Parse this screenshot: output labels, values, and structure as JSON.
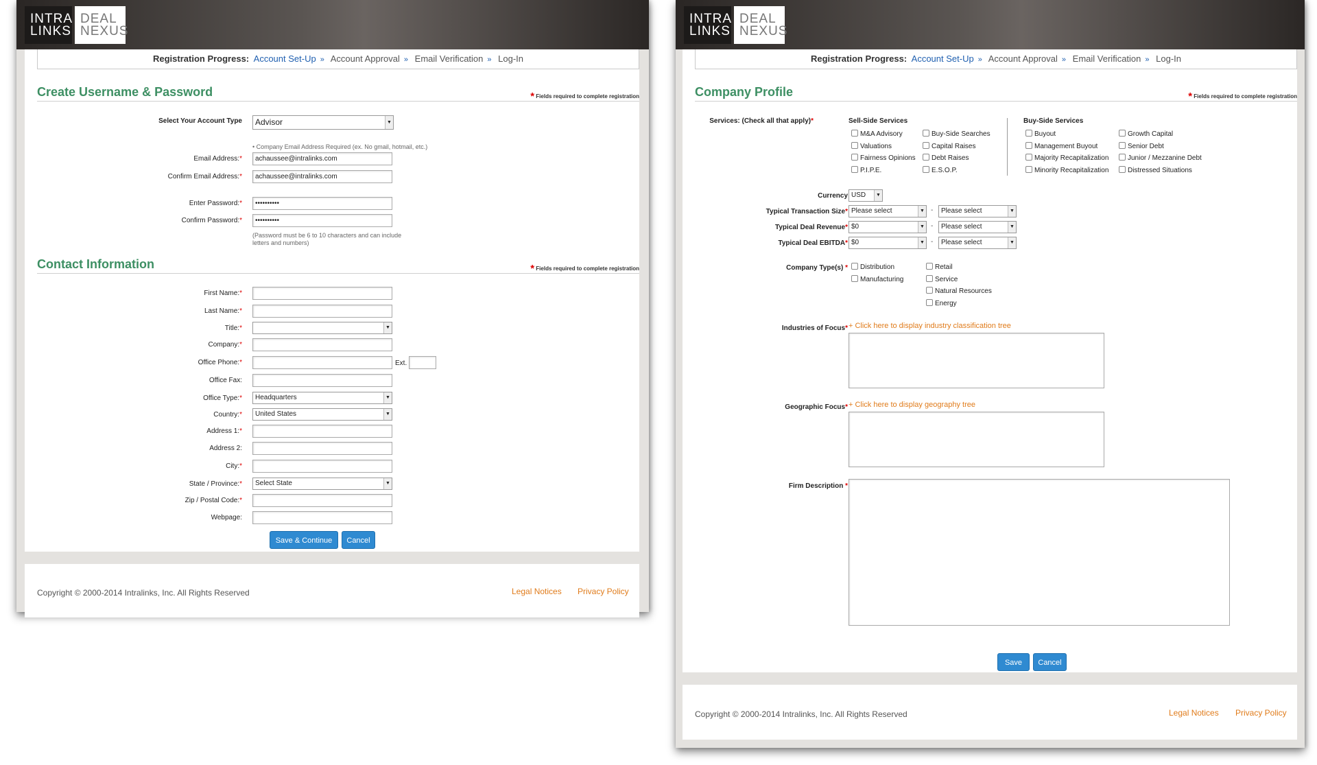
{
  "brand": {
    "logo_left_line1": "INTRA",
    "logo_left_line2": "LINKS",
    "logo_right_line1": "DEAL",
    "logo_right_line2": "NEXUS"
  },
  "progress": {
    "label": "Registration Progress:",
    "steps": [
      "Account Set-Up",
      "Account Approval",
      "Email Verification",
      "Log-In"
    ],
    "separator": "»"
  },
  "required_note": "Fields required to complete registration",
  "left": {
    "section1_title": "Create Username & Password",
    "account_type_label": "Select Your Account Type",
    "account_type_value": "Advisor",
    "email_note": "Company Email Address Required (ex. No gmail, hotmail, etc.)",
    "email_label": "Email Address:",
    "email_value": "achaussee@intralinks.com",
    "confirm_email_label": "Confirm Email Address:",
    "confirm_email_value": "achaussee@intralinks.com",
    "password_label": "Enter Password:",
    "password_value": "••••••••••",
    "confirm_password_label": "Confirm Password:",
    "confirm_password_value": "••••••••••",
    "password_note": "(Password must be 6 to 10 characters and can include letters and numbers)",
    "section2_title": "Contact Information",
    "first_name_label": "First Name:",
    "last_name_label": "Last Name:",
    "title_label": "Title:",
    "company_label": "Company:",
    "office_phone_label": "Office Phone:",
    "ext_label": "Ext.",
    "office_fax_label": "Office Fax:",
    "office_type_label": "Office Type:",
    "office_type_value": "Headquarters",
    "country_label": "Country:",
    "country_value": "United States",
    "address1_label": "Address 1:",
    "address2_label": "Address 2:",
    "city_label": "City:",
    "state_label": "State / Province:",
    "state_value": "Select State",
    "zip_label": "Zip / Postal Code:",
    "webpage_label": "Webpage:",
    "save_continue": "Save & Continue",
    "cancel": "Cancel"
  },
  "right": {
    "section_title": "Company Profile",
    "services_label": "Services: (Check all that apply)",
    "sell_side_header": "Sell-Side Services",
    "sell_side_col1": [
      "M&A Advisory",
      "Valuations",
      "Fairness Opinions",
      "P.I.P.E."
    ],
    "sell_side_col2": [
      "Buy-Side Searches",
      "Capital Raises",
      "Debt Raises",
      "E.S.O.P."
    ],
    "buy_side_header": "Buy-Side Services",
    "buy_side_col1": [
      "Buyout",
      "Management Buyout",
      "Majority Recapitalization",
      "Minority Recapitalization"
    ],
    "buy_side_col2": [
      "Growth Capital",
      "Senior Debt",
      "Junior / Mezzanine Debt",
      "Distressed Situations"
    ],
    "currency_label": "Currency",
    "currency_value": "USD",
    "transaction_size_label": "Typical Transaction Size",
    "transaction_size_from": "Please select",
    "transaction_size_to": "Please select",
    "deal_revenue_label": "Typical Deal Revenue",
    "deal_revenue_from": "$0",
    "deal_revenue_to": "Please select",
    "deal_ebitda_label": "Typical Deal EBITDA",
    "deal_ebitda_from": "$0",
    "deal_ebitda_to": "Please select",
    "range_dash": "-",
    "company_types_label": "Company Type(s)",
    "company_types_col1": [
      "Distribution",
      "Manufacturing"
    ],
    "company_types_col2": [
      "Retail",
      "Service",
      "Natural Resources",
      "Energy"
    ],
    "industries_label": "Industries of Focus",
    "industries_link": "+ Click here to display industry classification tree",
    "geo_label": "Geographic Focus",
    "geo_link": "+ Click here to display geography tree",
    "firm_desc_label": "Firm Description",
    "save": "Save",
    "cancel": "Cancel"
  },
  "footer": {
    "copyright": "Copyright © 2000-2014 Intralinks, Inc. All Rights Reserved",
    "legal": "Legal Notices",
    "privacy": "Privacy Policy"
  },
  "colors": {
    "accent": "#2f8ad1",
    "section_title": "#3d8f63",
    "link": "#e07b1a",
    "required": "#dd0000"
  }
}
